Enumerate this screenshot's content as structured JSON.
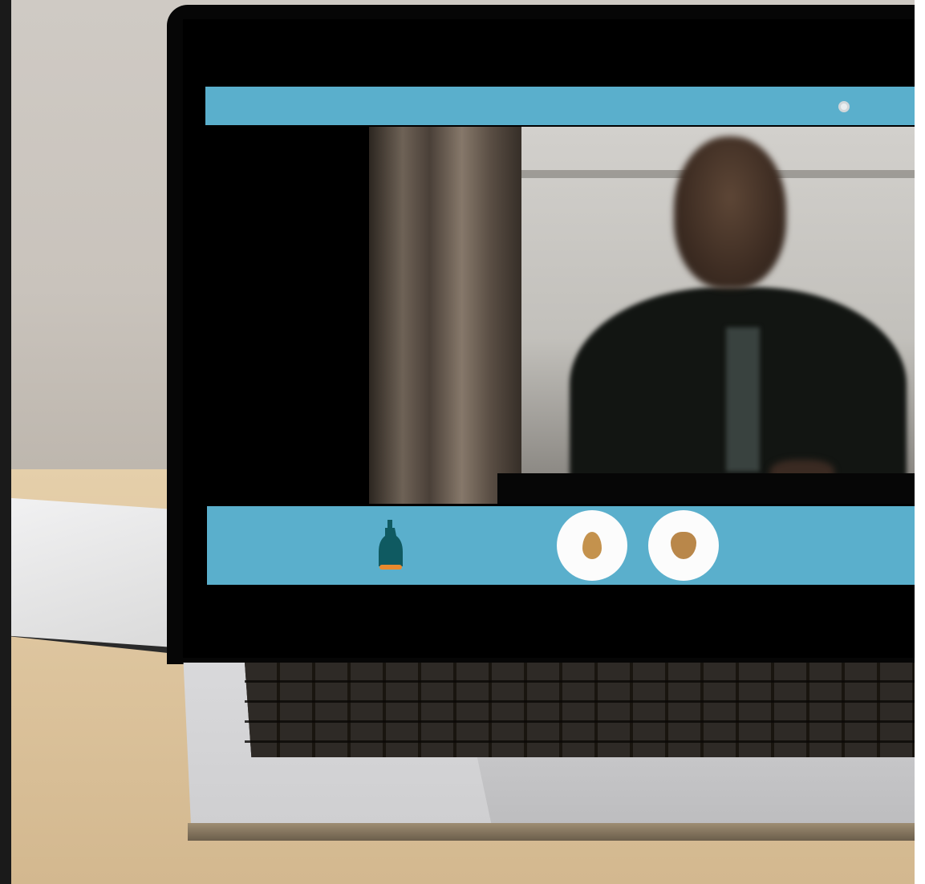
{
  "scene": {
    "description_free": true
  },
  "video_call": {
    "top_bar": {
      "status_icon": "status-dot-icon"
    },
    "bottom_bar": {
      "left_icon": "bell-icon",
      "buttons": [
        {
          "icon": "call-action-icon"
        },
        {
          "icon": "call-action-icon"
        }
      ]
    }
  },
  "colors": {
    "bar": "#5aafcc",
    "button_bg": "#fcfcfc",
    "button_glyph": "#c4924d",
    "bell_body": "#0f5a61",
    "bell_rim": "#e98a2e"
  }
}
